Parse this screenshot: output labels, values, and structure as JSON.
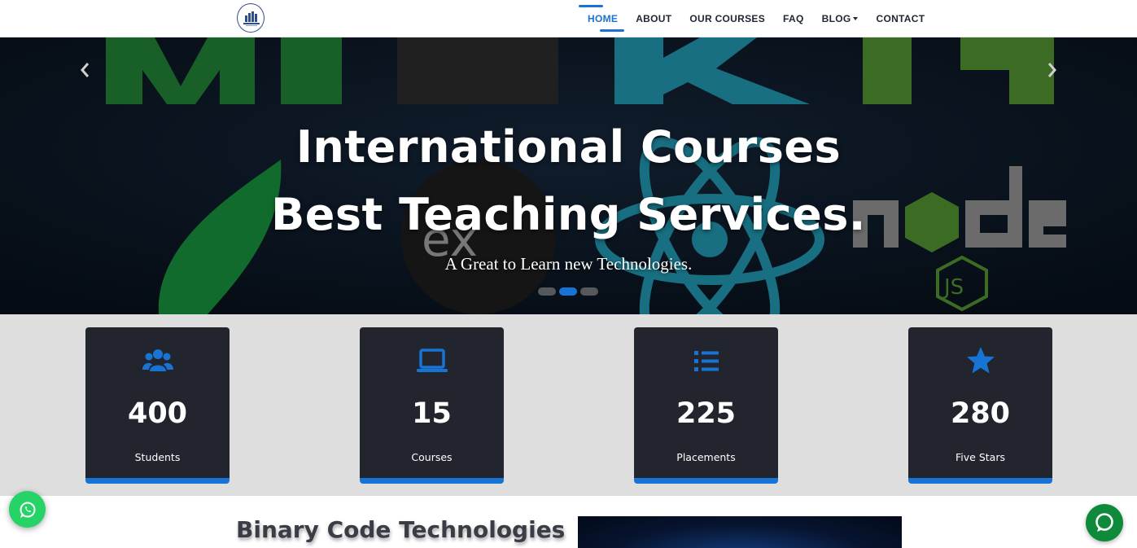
{
  "nav": {
    "logo_icon": "binary-code-logo",
    "items": [
      {
        "label": "HOME",
        "active": true
      },
      {
        "label": "ABOUT"
      },
      {
        "label": "OUR COURSES"
      },
      {
        "label": "FAQ"
      },
      {
        "label": "BLOG",
        "dropdown": true
      },
      {
        "label": "CONTACT"
      }
    ]
  },
  "hero": {
    "title_line1": "International Courses",
    "title_line2": "Best Teaching Services.",
    "subtitle": "A Great to Learn new Technologies.",
    "prev_icon": "chevron-left-icon",
    "next_icon": "chevron-right-icon",
    "slide_count": 3,
    "active_slide": 2
  },
  "stats": [
    {
      "icon": "users-icon",
      "number": "400",
      "label": "Students"
    },
    {
      "icon": "laptop-icon",
      "number": "15",
      "label": "Courses"
    },
    {
      "icon": "list-icon",
      "number": "225",
      "label": "Placements"
    },
    {
      "icon": "star-icon",
      "number": "280",
      "label": "Five Stars"
    }
  ],
  "about": {
    "heading": "Binary Code Technologies"
  },
  "floating": {
    "whatsapp_icon": "whatsapp-icon",
    "chat_icon": "chat-bubble-icon"
  },
  "colors": {
    "accent": "#1774d4",
    "card_bg": "#22252e",
    "stats_bg": "#dedede",
    "whatsapp": "#25d366",
    "chat": "#0f8a3a"
  }
}
